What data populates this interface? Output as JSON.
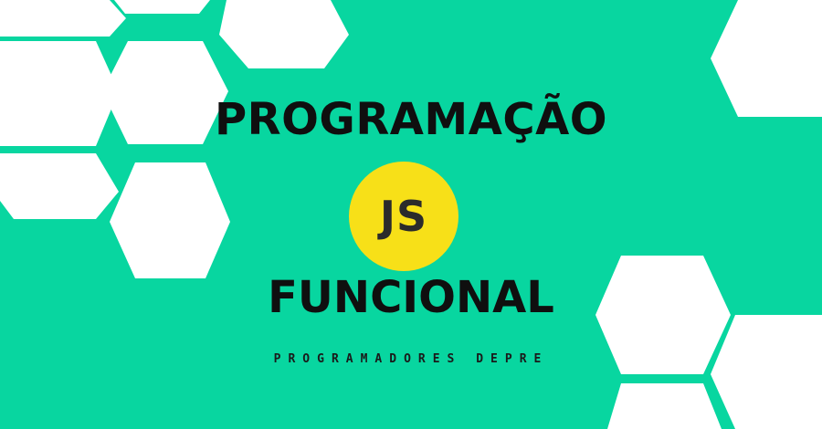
{
  "title": {
    "line1": "PROGRAMAÇÃO",
    "line2": "FUNCIONAL"
  },
  "logo": {
    "text": "JS",
    "background_color": "#f7e018",
    "text_color": "#2b2b2b"
  },
  "subtitle": "PROGRAMADORES DEPRE",
  "colors": {
    "background": "#08d6a0",
    "hexagons": "#ffffff",
    "title": "#0f0f0f"
  }
}
